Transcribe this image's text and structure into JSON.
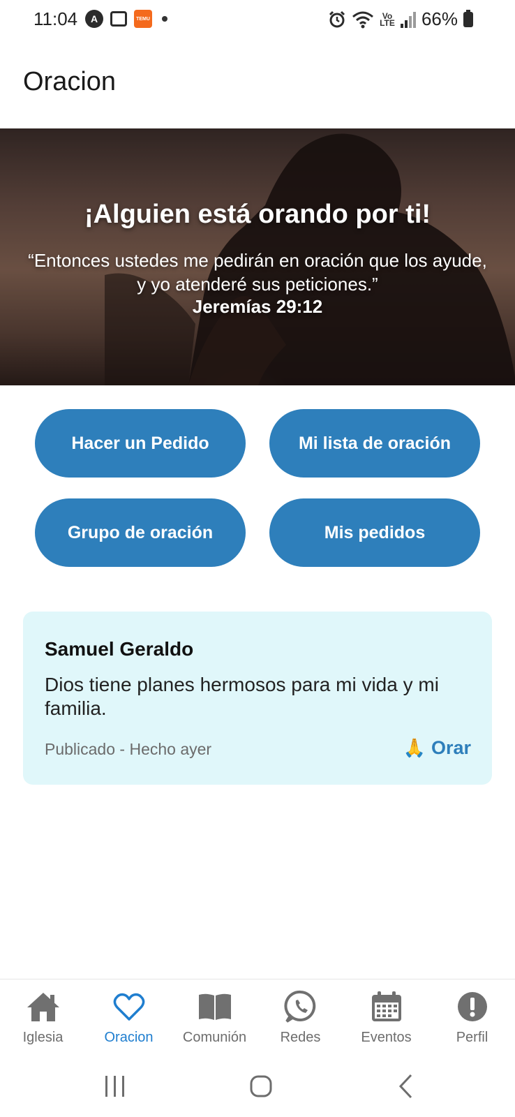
{
  "status_bar": {
    "time": "11:04",
    "notif_a_label": "A",
    "temu_label": "TEMU",
    "lte_label": "Vo LTE",
    "battery": "66%"
  },
  "header": {
    "title": "Oracion"
  },
  "hero": {
    "title": "¡Alguien está orando por ti!",
    "quote": "“Entonces ustedes me pedirán en oración que los ayude, y yo atenderé sus peticiones.”",
    "reference": "Jeremías 29:12"
  },
  "actions": {
    "make_request": "Hacer un Pedido",
    "my_prayer_list": "Mi lista de oración",
    "prayer_group": "Grupo de oración",
    "my_requests": "Mis pedidos"
  },
  "request_card": {
    "author": "Samuel Geraldo",
    "text": "Dios tiene planes hermosos para mi vida y mi familia.",
    "meta": "Publicado - Hecho ayer",
    "pray_emoji": "🙏",
    "pray_label": "Orar"
  },
  "bottom_nav": {
    "items": [
      {
        "label": "Iglesia",
        "icon": "home-icon"
      },
      {
        "label": "Oracion",
        "icon": "heart-icon",
        "active": true
      },
      {
        "label": "Comunión",
        "icon": "book-icon"
      },
      {
        "label": "Redes",
        "icon": "whatsapp-icon"
      },
      {
        "label": "Eventos",
        "icon": "calendar-icon"
      },
      {
        "label": "Perfil",
        "icon": "alert-icon"
      }
    ]
  },
  "colors": {
    "primary": "#2e7fbb",
    "active_nav": "#1f7ecf",
    "card_bg": "#e0f7fa",
    "nav_inactive": "#6d6d6d"
  }
}
